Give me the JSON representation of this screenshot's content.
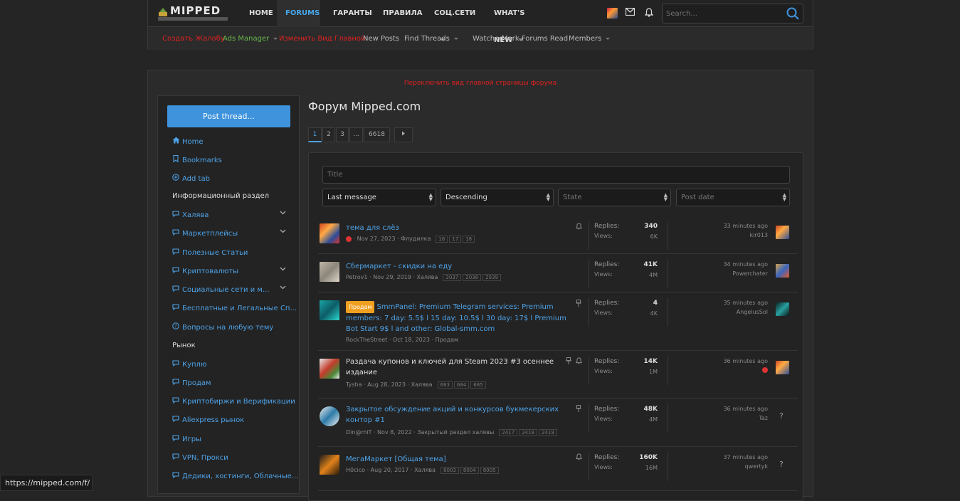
{
  "header": {
    "logo": {
      "name": "MIPPED",
      "tagline": "ИНФОРМАЦИОННЫЙ ПОРТАЛ"
    },
    "nav": [
      {
        "label": "HOME",
        "active": false
      },
      {
        "label": "FORUMS",
        "active": true
      },
      {
        "label": "ГАРАНТЫ",
        "active": false
      },
      {
        "label": "ПРАВИЛА",
        "active": false
      },
      {
        "label": "СОЦ.СЕТИ",
        "active": false
      },
      {
        "label": "WHAT'S NEW",
        "active": false
      }
    ],
    "icons": [
      "avatar",
      "envelope-icon",
      "bell-icon"
    ],
    "search_placeholder": "Search..."
  },
  "subnav": [
    {
      "label": "Создать Жалобу",
      "color": "#e02020"
    },
    {
      "label": "Ads Manager",
      "color": "#68b64a"
    },
    {
      "label": "Изменить Вид Главной",
      "color": "#e02020"
    },
    {
      "label": "New Posts",
      "color": "#bbbbbb"
    },
    {
      "label": "Find Threads",
      "color": "#bbbbbb"
    },
    {
      "label": "Watched",
      "color": "#bbbbbb"
    },
    {
      "label": "Mark Forums Read",
      "color": "#bbbbbb"
    },
    {
      "label": "Members",
      "color": "#bbbbbb"
    }
  ],
  "notice": "Переключить вид главной страницы форума",
  "sidebar": {
    "post_button": "Post thread...",
    "items": [
      {
        "label": "Home",
        "icon": "home-icon",
        "type": "link"
      },
      {
        "label": "Bookmarks",
        "icon": "bookmark-icon",
        "type": "link"
      },
      {
        "label": "Add tab",
        "icon": "add-icon",
        "type": "link"
      },
      {
        "label": "Информационный раздел",
        "type": "heading"
      },
      {
        "label": "Халява",
        "icon": "chat-icon",
        "type": "link",
        "expand": true
      },
      {
        "label": "Маркетплейсы",
        "icon": "chat-icon",
        "type": "link",
        "expand": true
      },
      {
        "label": "Полезные Статьи",
        "icon": "chat-icon",
        "type": "link"
      },
      {
        "label": "Криптовалюты",
        "icon": "chat-icon",
        "type": "link",
        "expand": true
      },
      {
        "label": "Социальные сети и м...",
        "icon": "chat-icon",
        "type": "link",
        "expand": true
      },
      {
        "label": "Бесплатные и Легальные Сп...",
        "icon": "chat-icon",
        "type": "link"
      },
      {
        "label": "Вопросы на любую тему",
        "icon": "question-icon",
        "type": "link"
      },
      {
        "label": "Рынок",
        "type": "heading"
      },
      {
        "label": "Куплю",
        "icon": "chat-icon",
        "type": "link"
      },
      {
        "label": "Продам",
        "icon": "chat-icon",
        "type": "link"
      },
      {
        "label": "Криптобиржи и Верификации",
        "icon": "chat-icon",
        "type": "link"
      },
      {
        "label": "Aliexpress рынок",
        "icon": "chat-icon",
        "type": "link"
      },
      {
        "label": "Игры",
        "icon": "chat-icon",
        "type": "link"
      },
      {
        "label": "VPN, Прокси",
        "icon": "chat-icon",
        "type": "link"
      },
      {
        "label": "Дедики, хостинги, Облачные...",
        "icon": "chat-icon",
        "type": "link"
      }
    ]
  },
  "forum": {
    "title": "Форум Mipped.com",
    "pages": [
      "1",
      "2",
      "3",
      "...",
      "6618"
    ],
    "current_page": "1",
    "filters": {
      "title_placeholder": "Title",
      "sort": "Last message",
      "order": "Descending",
      "state": "State",
      "post_date": "Post date"
    },
    "threads": [
      {
        "title": "тема для слёз",
        "prefix": "",
        "title_color": "blue",
        "author": "",
        "date": "Nov 27, 2023",
        "forum": "Флудилка",
        "pages": [
          "16",
          "17",
          "18"
        ],
        "icons": [
          "bell-icon"
        ],
        "replies": "340",
        "views": "6K",
        "last_time": "33 minutes ago",
        "last_user": "kir013",
        "has_avatar": true
      },
      {
        "title": "Сбермаркет - скидки на еду",
        "prefix": "",
        "title_color": "blue",
        "author": "Petrov1",
        "date": "Nov 29, 2019",
        "forum": "Халява",
        "pages": [
          "2037",
          "2038",
          "2039"
        ],
        "icons": [],
        "replies": "41K",
        "views": "4M",
        "last_time": "34 minutes ago",
        "last_user": "Powerchater",
        "has_avatar": true
      },
      {
        "title": "SmmPanel: Premium Telegram services: Premium members: 7 day: 5.5$ l 15 day: 10.5$ l 30 day: 17$ l Premium Bot Start 9$ l and other: Global-smm.com",
        "prefix": "Продам",
        "title_color": "blue",
        "author": "RockTheStreet",
        "date": "Oct 18, 2023",
        "forum": "Продам",
        "pages": [],
        "icons": [
          "pin-icon"
        ],
        "replies": "4",
        "views": "4K",
        "last_time": "35 minutes ago",
        "last_user": "AngelusSol",
        "has_avatar": true
      },
      {
        "title": "Раздача купонов и ключей для Steam 2023 #3 осеннее издание",
        "prefix": "",
        "title_color": "white",
        "author": "Tysha",
        "date": "Aug 28, 2023",
        "forum": "Халява",
        "pages": [
          "683",
          "684",
          "685"
        ],
        "icons": [
          "pin-icon",
          "bell-icon"
        ],
        "replies": "14K",
        "views": "1M",
        "last_time": "36 minutes ago",
        "last_user": "",
        "has_avatar": true
      },
      {
        "title": "Закрытое обсуждение акций и конкурсов букмекерских контор #1",
        "prefix": "",
        "title_color": "blue",
        "author": "Din@miT",
        "date": "Nov 8, 2022",
        "forum": "Закрытый раздел халявы",
        "pages": [
          "2417",
          "2418",
          "2419"
        ],
        "icons": [
          "pin-icon"
        ],
        "replies": "48K",
        "views": "4M",
        "last_time": "36 minutes ago",
        "last_user": "Taz",
        "has_avatar": false
      },
      {
        "title": "МегаМаркет [Общая тема]",
        "prefix": "",
        "title_color": "blue",
        "author": "H0cico",
        "date": "Aug 20, 2017",
        "forum": "Халява",
        "pages": [
          "8003",
          "8004",
          "8005"
        ],
        "icons": [
          "bell-icon"
        ],
        "replies": "160K",
        "views": "16M",
        "last_time": "37 minutes ago",
        "last_user": "qwertyk",
        "has_avatar": false
      }
    ],
    "labels": {
      "replies": "Replies:",
      "views": "Views:"
    }
  },
  "statusbar": "https://mipped.com/f/"
}
